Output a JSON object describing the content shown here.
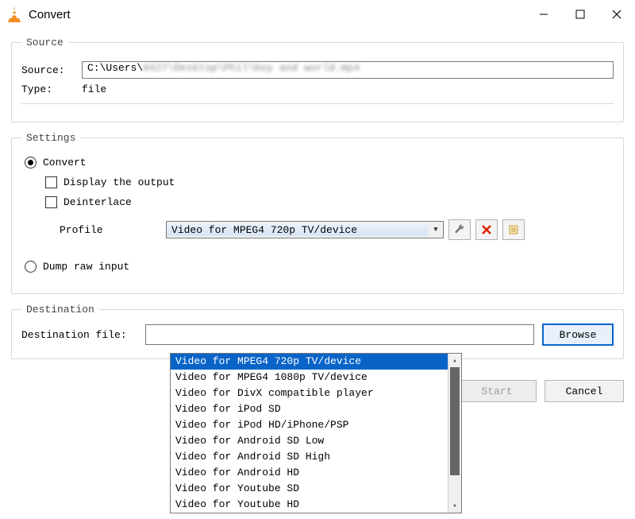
{
  "window": {
    "title": "Convert",
    "minimize": "—",
    "maximize": "☐",
    "close": "✕"
  },
  "source_group": {
    "legend": "Source",
    "source_label": "Source:",
    "source_value": "C:\\Users\\",
    "source_value_blurred": "0427\\Desktop\\Phil\\boy and world.mp4",
    "type_label": "Type:",
    "type_value": "file"
  },
  "settings_group": {
    "legend": "Settings",
    "convert_label": "Convert",
    "display_output_label": "Display the output",
    "deinterlace_label": "Deinterlace",
    "profile_label": "Profile",
    "profile_selected": "Video for MPEG4 720p TV/device",
    "dump_raw_label": "Dump raw input",
    "wrench_icon": "wrench-icon",
    "delete_icon": "x-icon",
    "new_icon": "new-profile-icon"
  },
  "profile_options": [
    "Video for MPEG4 720p TV/device",
    "Video for MPEG4 1080p TV/device",
    "Video for DivX compatible player",
    "Video for iPod SD",
    "Video for iPod HD/iPhone/PSP",
    "Video for Android SD Low",
    "Video for Android SD High",
    "Video for Android HD",
    "Video for Youtube SD",
    "Video for Youtube HD"
  ],
  "destination_group": {
    "legend": "Destination",
    "dest_label": "Destination file:",
    "browse_label": "Browse"
  },
  "buttons": {
    "start": "Start",
    "cancel": "Cancel"
  }
}
